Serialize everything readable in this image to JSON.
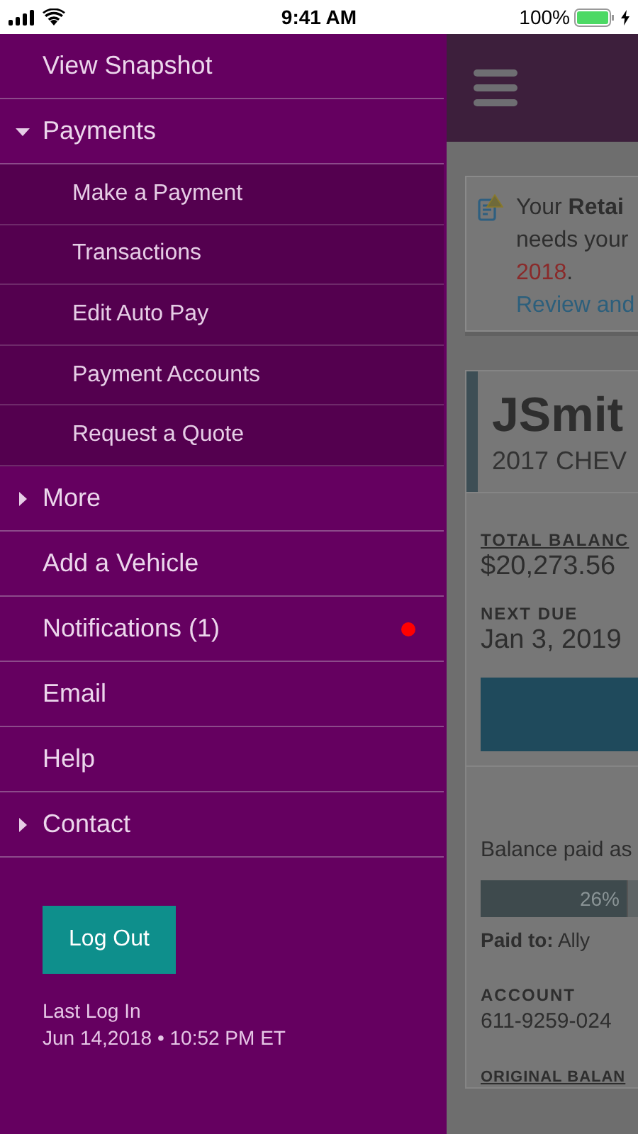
{
  "status_bar": {
    "time": "9:41 AM",
    "battery": "100%"
  },
  "menu": [
    {
      "kind": "link",
      "label": "View Snapshot"
    },
    {
      "kind": "group",
      "label": "Payments",
      "expanded": true,
      "children": [
        {
          "label": "Make a Payment"
        },
        {
          "label": "Transactions"
        },
        {
          "label": "Edit Auto Pay"
        },
        {
          "label": "Payment Accounts"
        },
        {
          "label": "Request a Quote"
        }
      ]
    },
    {
      "kind": "group",
      "label": "More",
      "expanded": false
    },
    {
      "kind": "link",
      "label": "Add a Vehicle"
    },
    {
      "kind": "link",
      "label": "Notifications (1)",
      "color": "#ff0000"
    },
    {
      "kind": "link",
      "label": "Email"
    },
    {
      "kind": "link",
      "label": "Help"
    },
    {
      "kind": "group",
      "label": "Contact",
      "expanded": false
    }
  ],
  "logout": {
    "button": "Log Out",
    "last_login_label": "Last Log In",
    "last_login": "Jun 14,2018 • 10:52 PM ET"
  },
  "background_page": {
    "notice": {
      "lines": [
        "Your **Retai**",
        "needs your"
      ],
      "date": "2018",
      "date_suffix": ".",
      "link": "Review and"
    },
    "vehicle": {
      "nickname": "JSmit",
      "model": "2017 CHEV",
      "total_balance_label": "TOTAL BALANC",
      "total_balance": "$20,273.56",
      "next_due_label": "NEXT DUE",
      "next_due": "Jan 3, 2019",
      "balance_paid_label": "Balance paid as",
      "progress": {
        "level": 0.26,
        "reading": "26%"
      },
      "paid_to": "**Paid to:** Ally",
      "account_label": "ACCOUNT",
      "account": "611-9259-024",
      "original_balance_label": "ORIGINAL BALAN"
    }
  }
}
